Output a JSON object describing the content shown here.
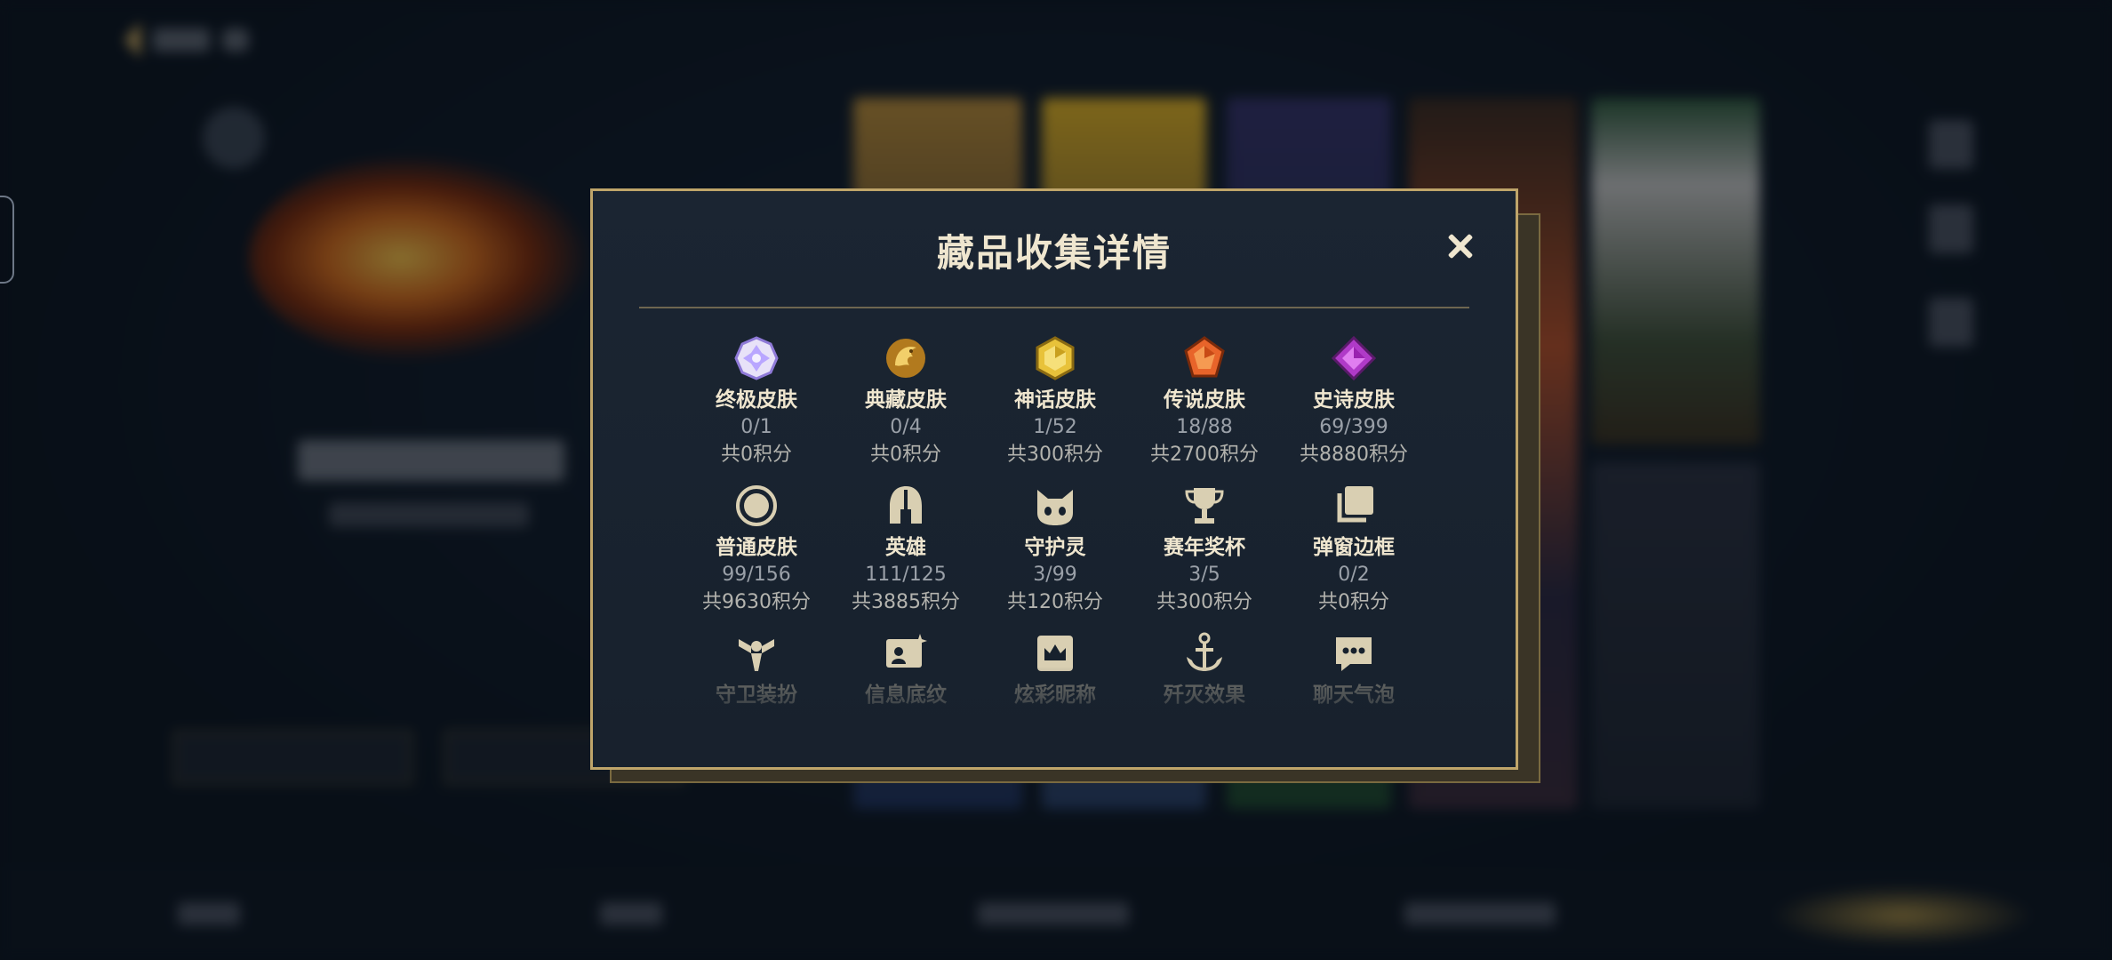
{
  "modal": {
    "title": "藏品收集详情",
    "close_icon": "close-icon"
  },
  "collections": [
    {
      "name": "终极皮肤",
      "count": "0/1",
      "points": "共0积分",
      "icon": "ultimate-gem-icon",
      "color": "#b9a6ff"
    },
    {
      "name": "典藏皮肤",
      "count": "0/4",
      "points": "共0积分",
      "icon": "prestige-dragon-icon",
      "color": "#e0a63a"
    },
    {
      "name": "神话皮肤",
      "count": "1/52",
      "points": "共300积分",
      "icon": "mythic-gem-icon",
      "color": "#e8c23a"
    },
    {
      "name": "传说皮肤",
      "count": "18/88",
      "points": "共2700积分",
      "icon": "legendary-gem-icon",
      "color": "#e8642a"
    },
    {
      "name": "史诗皮肤",
      "count": "69/399",
      "points": "共8880积分",
      "icon": "epic-gem-icon",
      "color": "#b03ac8"
    },
    {
      "name": "普通皮肤",
      "count": "99/156",
      "points": "共9630积分",
      "icon": "circle-icon",
      "color": "#d9cfb2"
    },
    {
      "name": "英雄",
      "count": "111/125",
      "points": "共3885积分",
      "icon": "helmet-icon",
      "color": "#d9cfb2"
    },
    {
      "name": "守护灵",
      "count": "3/99",
      "points": "共120积分",
      "icon": "spirit-icon",
      "color": "#d9cfb2"
    },
    {
      "name": "赛年奖杯",
      "count": "3/5",
      "points": "共300积分",
      "icon": "trophy-icon",
      "color": "#d9cfb2"
    },
    {
      "name": "弹窗边框",
      "count": "0/2",
      "points": "共0积分",
      "icon": "frame-icon",
      "color": "#d9cfb2"
    },
    {
      "name": "守卫装扮",
      "icon": "ward-icon",
      "color": "#d9cfb2"
    },
    {
      "name": "信息底纹",
      "icon": "info-card-icon",
      "color": "#d9cfb2"
    },
    {
      "name": "炫彩昵称",
      "icon": "crown-badge-icon",
      "color": "#d9cfb2"
    },
    {
      "name": "歼灭效果",
      "icon": "anchor-icon",
      "color": "#d9cfb2"
    },
    {
      "name": "聊天气泡",
      "icon": "chat-bubble-icon",
      "color": "#d9cfb2"
    }
  ],
  "colors": {
    "accent_gold": "#bfa56a",
    "modal_bg": "#1b2532",
    "text_main": "#efe6cf",
    "text_muted": "#9aa0a8"
  }
}
